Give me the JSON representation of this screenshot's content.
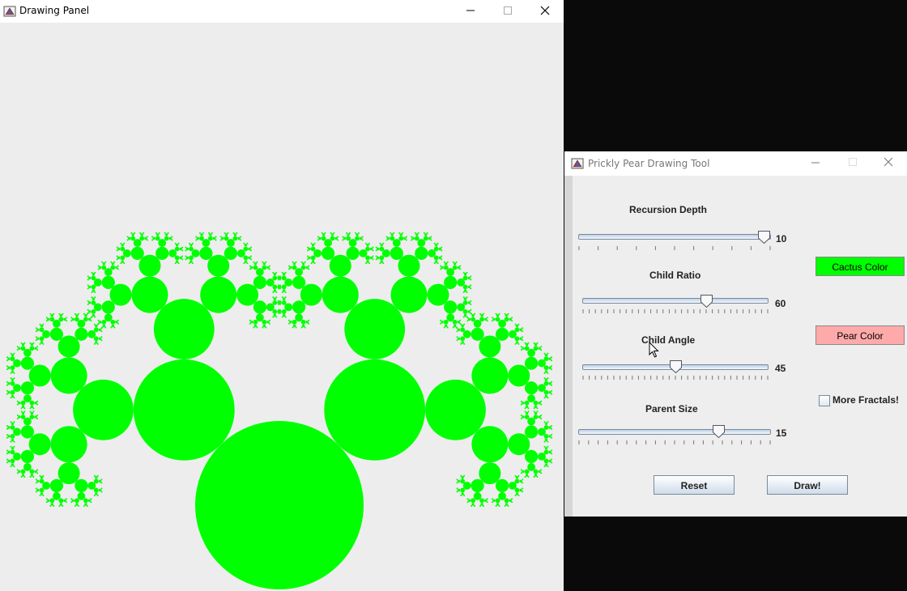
{
  "drawing_window": {
    "title": "Drawing Panel",
    "fractal_color": "#00ff00",
    "background_color": "#ededed"
  },
  "tool_window": {
    "title": "Prickly Pear Drawing Tool",
    "sliders": [
      {
        "label": "Recursion Depth",
        "value": "10",
        "fraction": 1.0
      },
      {
        "label": "Child Ratio",
        "value": "60",
        "fraction": 0.66
      },
      {
        "label": "Child Angle",
        "value": "45",
        "fraction": 0.5
      },
      {
        "label": "Parent Size",
        "value": "15",
        "fraction": 0.75
      }
    ],
    "cactus_button": {
      "label": "Cactus Color",
      "color": "#00ff00"
    },
    "pear_button": {
      "label": "Pear Color",
      "color": "#ffaaaa"
    },
    "more_fractals": {
      "label": "More Fractals!",
      "checked": false
    },
    "reset_label": "Reset",
    "draw_label": "Draw!"
  }
}
